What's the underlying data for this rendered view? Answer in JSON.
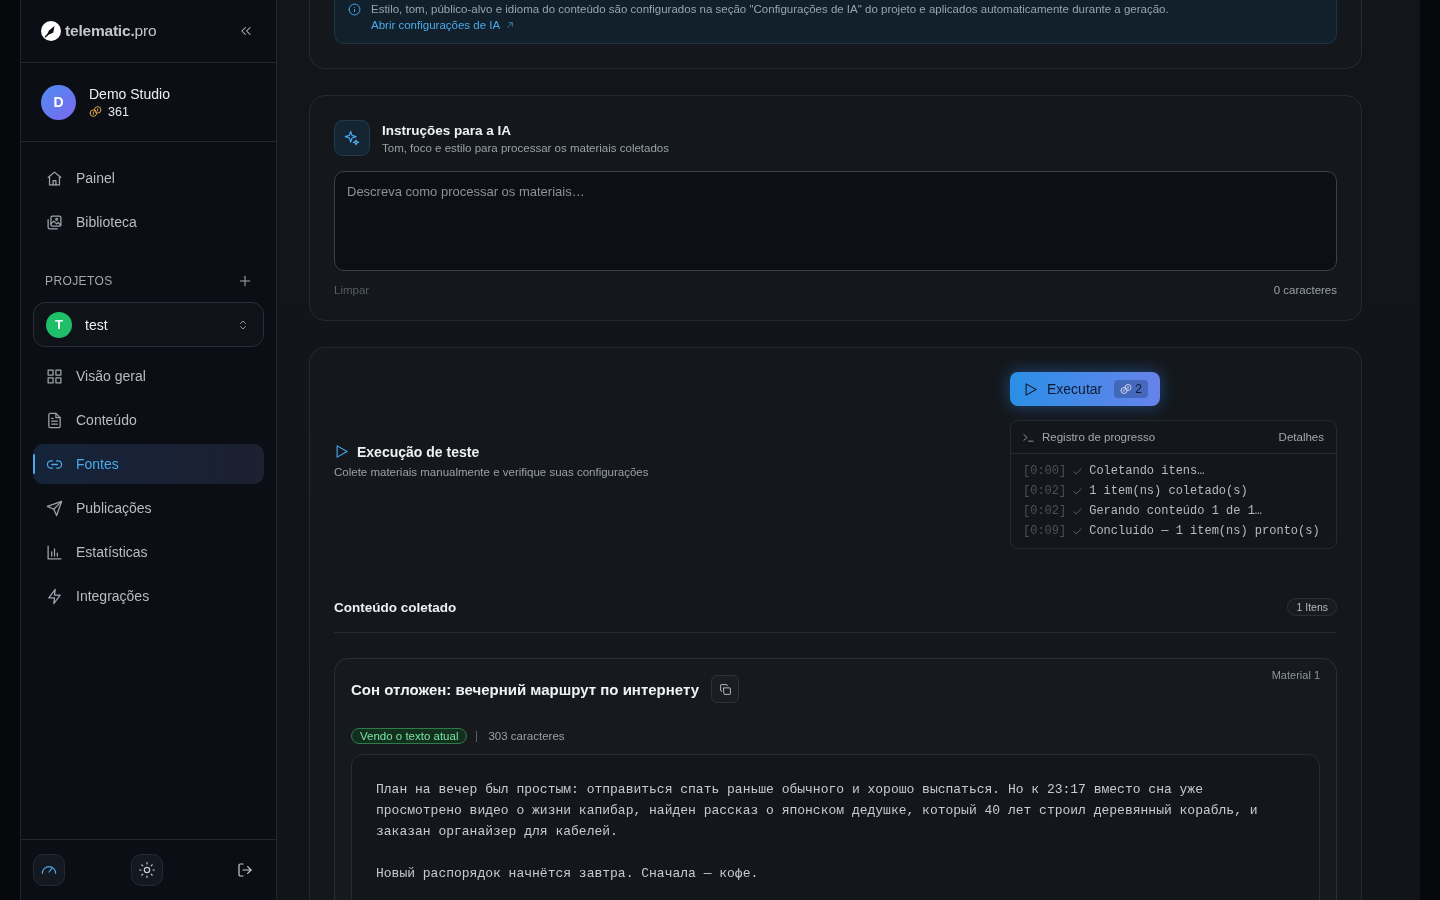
{
  "sidebar": {
    "logo": "**telematic.**pro",
    "account": {
      "avatar_letter": "D",
      "name": "Demo Studio",
      "credits": "361"
    },
    "nav_items": [
      {
        "label": "Painel",
        "selected": false
      },
      {
        "label": "Biblioteca",
        "selected": false
      }
    ],
    "projects": {
      "heading": "PROJETOS",
      "current": {
        "avatar_letter": "T",
        "name": "test"
      }
    },
    "project_nav": [
      {
        "label": "Visão geral",
        "selected": false
      },
      {
        "label": "Conteúdo",
        "selected": false
      },
      {
        "label": "Fontes",
        "selected": true
      },
      {
        "label": "Publicações",
        "selected": false
      },
      {
        "label": "Estatísticas",
        "selected": false
      },
      {
        "label": "Integrações",
        "selected": false
      }
    ]
  },
  "ai_settings_notice": {
    "text": "Estilo, tom, público-alvo e idioma do conteúdo são configurados na seção \"Configurações de IA\" do projeto e aplicados automaticamente durante a geração.",
    "link": "Abrir configurações de IA"
  },
  "ai_instructions": {
    "title": "Instruções para a IA",
    "subtitle": "Tom, foco e estilo para processar os materiais coletados",
    "placeholder": "Descreva como processar os materiais…",
    "clear_button": {
      "label": "Limpar",
      "disabled": true
    },
    "char_count": "0 caracteres"
  },
  "test_run": {
    "title": "Execução de teste",
    "subtitle": "Colete materiais manualmente e verifique suas configurações",
    "run_button": {
      "label": "Executar",
      "cost": "2"
    },
    "progress_log": {
      "title": "Registro de progresso",
      "details_link": "Detalhes",
      "entries": [
        {
          "time": "[0:00]",
          "done": true,
          "message": "Coletando itens…"
        },
        {
          "time": "[0:02]",
          "done": true,
          "message": "1 item(ns) coletado(s)"
        },
        {
          "time": "[0:02]",
          "done": true,
          "message": "Gerando conteúdo 1 de 1…"
        },
        {
          "time": "[0:09]",
          "done": true,
          "message": "Concluído — 1 item(ns) pronto(s)"
        }
      ]
    }
  },
  "collected": {
    "title": "Conteúdo coletado",
    "count": "1 Itens",
    "materials": [
      {
        "title": "Сон отложен: вечерний маршрут по интернету",
        "label": "Material 1",
        "status_tag": "Vendo o texto atual",
        "char_count": "303 caracteres",
        "paragraphs": [
          "План на вечер был простым: отправиться спать раньше обычного и хорошо выспаться. Но к 23:17 вместо сна уже просмотрено видео о жизни капибар, найден рассказ о японском дедушке, который 40 лет строил деревянный корабль, и заказан органайзер для кабелей.",
          "Новый распорядок начнётся завтра. Сначала — кофе."
        ]
      }
    ]
  }
}
